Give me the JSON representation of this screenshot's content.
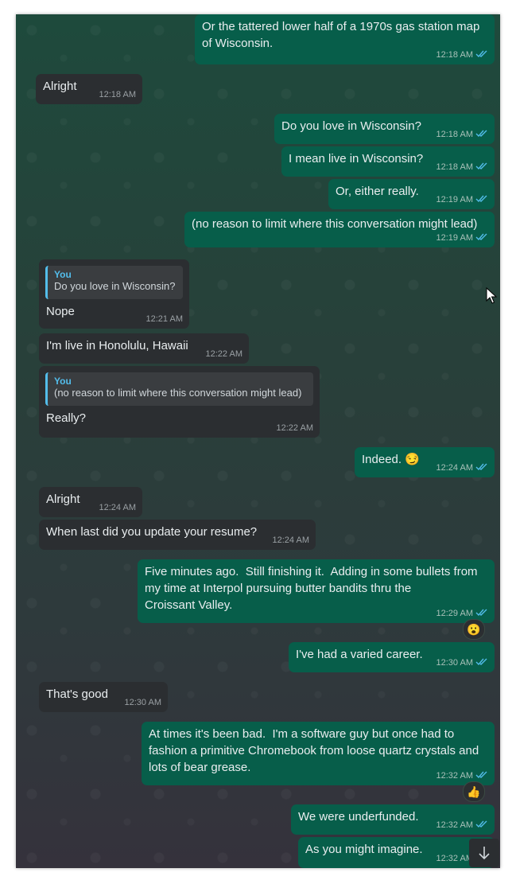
{
  "messages": [
    {
      "dir": "out",
      "lines": "Or the tattered lower half of a 1970s gas station map\nof Wisconsin.",
      "time": "12:18 AM"
    },
    {
      "dir": "in",
      "lines": "Alright",
      "time": "12:18 AM"
    },
    {
      "dir": "out",
      "lines": "Do you love in Wisconsin?",
      "time": "12:18 AM"
    },
    {
      "dir": "out",
      "lines": "I mean live in Wisconsin?",
      "time": "12:18 AM"
    },
    {
      "dir": "out",
      "lines": "Or, either really.",
      "time": "12:19 AM"
    },
    {
      "dir": "out",
      "lines": "(no reason to limit where this conversation might lead)",
      "time": "12:19 AM"
    },
    {
      "dir": "in",
      "lines": "Nope",
      "time": "12:21 AM",
      "quote": {
        "name": "You",
        "text": "Do you love in Wisconsin?"
      }
    },
    {
      "dir": "in",
      "lines": "I'm live in Honolulu, Hawaii",
      "time": "12:22 AM"
    },
    {
      "dir": "in",
      "lines": "Really?",
      "time": "12:22 AM",
      "quote": {
        "name": "You",
        "text": "(no reason to limit where this conversation might lead)"
      }
    },
    {
      "dir": "out",
      "lines": "Indeed. 😏",
      "time": "12:24 AM"
    },
    {
      "dir": "in",
      "lines": "Alright",
      "time": "12:24 AM"
    },
    {
      "dir": "in",
      "lines": "When last did you update your resume?",
      "time": "12:24 AM"
    },
    {
      "dir": "out",
      "lines": "Five minutes ago.  Still finishing it.  Adding in some bullets from\nmy time at Interpol pursuing butter bandits thru the\nCroissant Valley.",
      "time": "12:29 AM",
      "reaction": "😮"
    },
    {
      "dir": "out",
      "lines": "I've had a varied career.",
      "time": "12:30 AM"
    },
    {
      "dir": "in",
      "lines": "That's good",
      "time": "12:30 AM"
    },
    {
      "dir": "out",
      "lines": "At times it's been bad.  I'm a software guy but once had to\nfashion a primitive Chromebook from loose quartz crystals and\nlots of bear grease.",
      "time": "12:32 AM",
      "reaction": "👍"
    },
    {
      "dir": "out",
      "lines": "We were underfunded.",
      "time": "12:32 AM"
    },
    {
      "dir": "out",
      "lines": "As you might imagine.",
      "time": "12:32 AM"
    }
  ],
  "icons": {
    "read_ticks": "double-check-icon",
    "scroll": "arrow-down-icon",
    "cursor": "mouse-pointer-icon"
  },
  "colors": {
    "outgoing_bubble": "#075e4a",
    "incoming_bubble": "#2b2e31",
    "quote_accent": "#53bdeb",
    "read_ticks": "#53bdeb"
  }
}
